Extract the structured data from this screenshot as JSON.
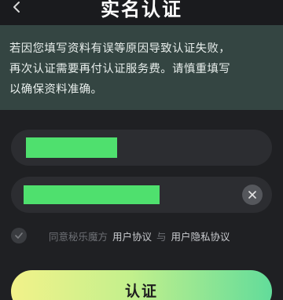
{
  "header": {
    "title": "实名认证",
    "back_icon": "chevron-left-icon"
  },
  "notice": {
    "lines": [
      "若因您填写资料有误等原因导致认证失败，",
      "再次认证需要再付认证服务费。请慎重填写",
      "以确保资料准确。"
    ]
  },
  "form": {
    "name_field": {
      "value_masked": true
    },
    "id_field": {
      "value_masked": true,
      "clear_icon": "close-icon"
    }
  },
  "agreement": {
    "checkbox_icon": "check-icon",
    "prefix": "同意秘乐魔方",
    "user_agreement": "用户协议",
    "conjunction": "与",
    "privacy_agreement": "用户隐私协议"
  },
  "submit": {
    "label": "认证"
  },
  "colors": {
    "background": "#1f2023",
    "notice_bg": "#344542",
    "mask": "#4fe06e",
    "gradient_start": "#f2f28a",
    "gradient_end": "#62dc9a"
  }
}
